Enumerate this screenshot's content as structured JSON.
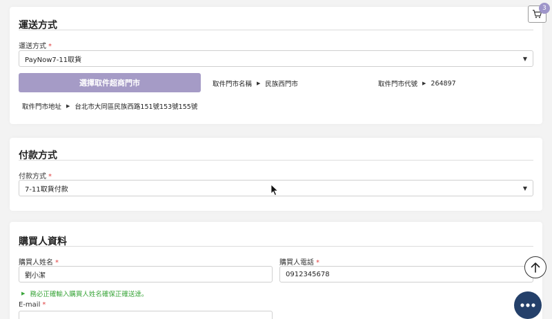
{
  "shipping": {
    "title": "運送方式",
    "label": "運送方式",
    "required_mark": "*",
    "selected": "PayNow7-11取貨",
    "store_button": "選擇取件超商門市",
    "store_name_label": "取件門市名稱",
    "store_name_value": "民族西門市",
    "store_code_label": "取件門市代號",
    "store_code_value": "264897",
    "store_address_label": "取件門市地址",
    "store_address_value": "台北市大同區民族西路151號153號155號"
  },
  "payment": {
    "title": "付款方式",
    "label": "付款方式",
    "required_mark": "*",
    "selected": "7-11取貨付款"
  },
  "buyer": {
    "title": "購買人資料",
    "name_label": "購買人姓名",
    "name_value": "劉小潔",
    "phone_label": "購買人電話",
    "phone_value": "0912345678",
    "hint": "務必正確輸入購買人姓名確保正確送達。",
    "email_label": "E-mail",
    "required_mark": "*"
  },
  "cart": {
    "count": "3"
  },
  "colors": {
    "store_button_bg": "#a59bc6",
    "badge_bg": "#9e95c9",
    "chat_bg": "#24406a",
    "hint_green": "#3aa53a",
    "required_red": "#e04040"
  },
  "icons": {
    "cart": "shopping-cart-icon",
    "back_to_top": "arrow-up-icon",
    "chat": "chat-dots-icon",
    "select_caret": "caret-down-icon",
    "info_bullet": "triangle-right-icon"
  }
}
